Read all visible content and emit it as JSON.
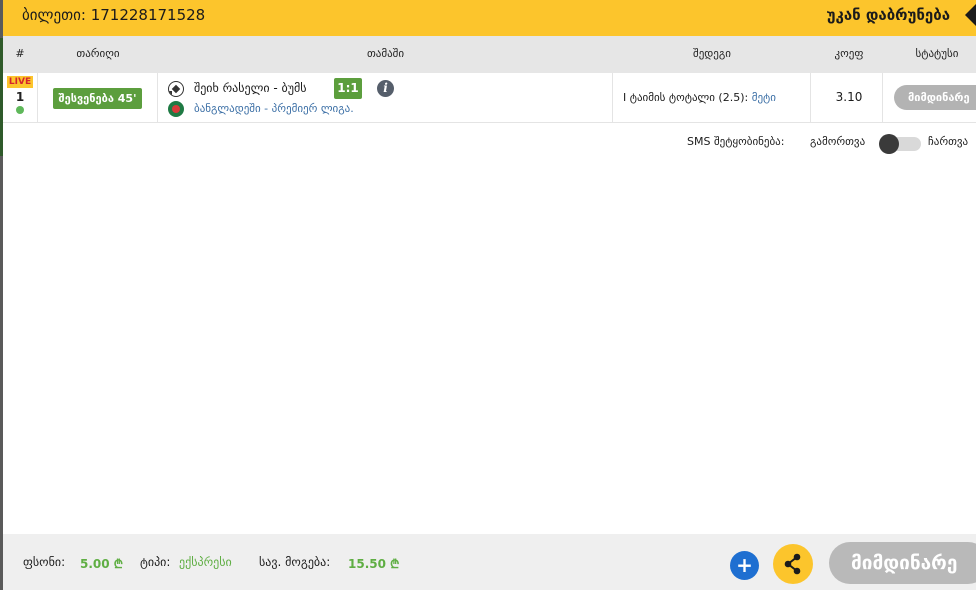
{
  "header": {
    "ticket_label": "ბილეთი: 171228171528",
    "back_label": "უკან დაბრუნება"
  },
  "table": {
    "columns": [
      "#",
      "თარიღი",
      "თამაში",
      "შედეგი",
      "კოეფ",
      "სტატუსი"
    ],
    "rows": [
      {
        "live_badge": "LIVE",
        "number": "1",
        "time_badge": "შესვენება 45'",
        "match": "შეიხ რასელი - ბუმს",
        "score": "1:1",
        "league": "ბანგლადეში - პრემიერ ლიგა.",
        "result_label": "I ტაიმის ტოტალი (2.5): ",
        "result_value": "მეტი",
        "odds": "3.10",
        "status": "მიმდინარე"
      }
    ]
  },
  "sms": {
    "label": "SMS შეტყობინება:",
    "off_label": "გამორთვა",
    "on_label": "ჩართვა",
    "enabled": false
  },
  "footer": {
    "stake_label": "ფსონი:",
    "stake_value": "5.00 ₾",
    "type_label": "ტიპი:",
    "type_value": "ექსპრესი",
    "win_label": "სავ. მოგება:",
    "win_value": "15.50 ₾",
    "add_label": "+",
    "status_label": "მიმდინარე"
  },
  "colors": {
    "accent": "#fcc52c",
    "live_green": "#5c9e3d",
    "link_blue": "#3a6ea5",
    "add_blue": "#1e6fd1",
    "status_gray": "#b3b3b3"
  },
  "icons": [
    "info-icon",
    "soccer-ball-icon",
    "bangladesh-flag-icon",
    "share-icon",
    "plus-icon",
    "back-arrow-icon"
  ]
}
